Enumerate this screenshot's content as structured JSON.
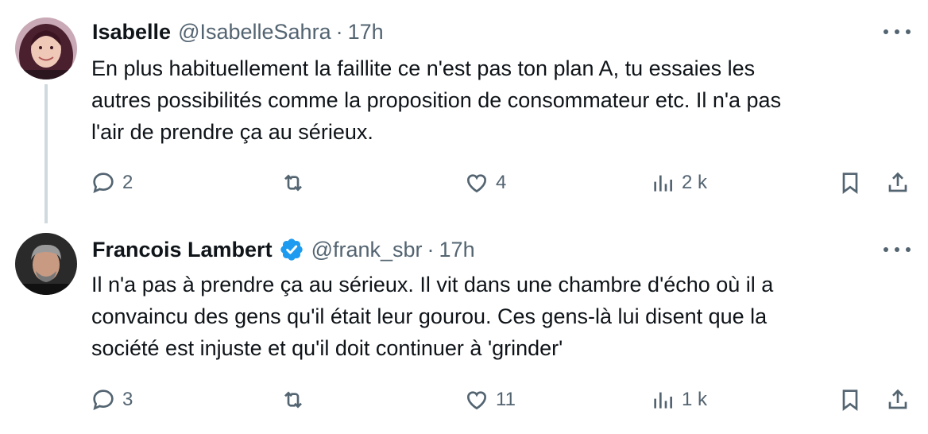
{
  "tweets": [
    {
      "display_name": "Isabelle",
      "handle": "@IsabelleSahra",
      "separator": "·",
      "time": "17h",
      "verified": false,
      "text_lines": [
        "En plus habituellement la faillite ce n'est pas ton plan A, tu essaies les",
        "autres possibilités comme la proposition de consommateur etc. Il n'a pas",
        "l'air de prendre ça au sérieux."
      ],
      "replies": "2",
      "retweets": "",
      "likes": "4",
      "views": "2 k"
    },
    {
      "display_name": "Francois Lambert",
      "handle": "@frank_sbr",
      "separator": "·",
      "time": "17h",
      "verified": true,
      "text_lines": [
        "Il n'a pas à prendre ça au sérieux. Il vit dans une chambre d'écho où il a",
        "convaincu des gens qu'il était leur gourou. Ces gens-là lui disent que la",
        "société est injuste et qu'il doit continuer à 'grinder'"
      ],
      "replies": "3",
      "retweets": "",
      "likes": "11",
      "views": "1 k"
    }
  ],
  "colors": {
    "text": "#0f1419",
    "secondary": "#536471",
    "verified": "#1d9bf0",
    "thread_line": "#cfd9de"
  }
}
